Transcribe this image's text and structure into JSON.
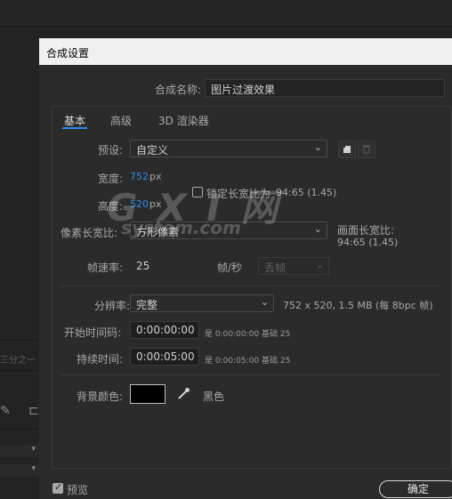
{
  "background": {
    "fragment_text": "三分之一"
  },
  "dialog": {
    "title": "合成设置",
    "comp_name_label": "合成名称:",
    "comp_name_value": "图片过渡效果",
    "tabs": [
      {
        "label": "基本",
        "active": true
      },
      {
        "label": "高级",
        "active": false
      },
      {
        "label": "3D 渲染器",
        "active": false
      }
    ],
    "preset_label": "预设:",
    "preset_value": "自定义",
    "width_label": "宽度:",
    "width_value": "752",
    "width_unit": "px",
    "height_label": "高度:",
    "height_value": "520",
    "height_unit": "px",
    "lock_ratio_label": "锁定长宽比为",
    "lock_ratio_value": "94:65 (1.45)",
    "lock_ratio_checked": false,
    "pixel_aspect_label": "像素长宽比:",
    "pixel_aspect_value": "方形像素",
    "frame_aspect_label": "画面长宽比:",
    "frame_aspect_value": "94:65 (1.45)",
    "frame_rate_label": "帧速率:",
    "frame_rate_value": "25",
    "frame_rate_unit": "帧/秒",
    "frame_rate_mode": "丢帧",
    "resolution_label": "分辨率:",
    "resolution_value": "完整",
    "resolution_info": "752 x 520, 1.5 MB (每 8bpc 帧)",
    "start_tc_label": "开始时间码:",
    "start_tc_value": "0:00:00:00",
    "start_tc_info": "是 0:00:00:00",
    "start_tc_base": "基础 25",
    "duration_label": "持续时间:",
    "duration_value": "0:00:05:00",
    "duration_info": "是 0:00:05:00",
    "duration_base": "基础 25",
    "bg_color_label": "背景颜色:",
    "bg_color_name": "黑色",
    "bg_color_hex": "#000000",
    "preview_label": "预览",
    "preview_checked": true,
    "ok_label": "确定"
  },
  "watermark": {
    "big": "G X I 网",
    "small": "system.com"
  },
  "colors": {
    "accent": "#2d8ceb",
    "dialog_bg": "#2b2b2b",
    "titlebar_bg": "#f0f0f0"
  }
}
